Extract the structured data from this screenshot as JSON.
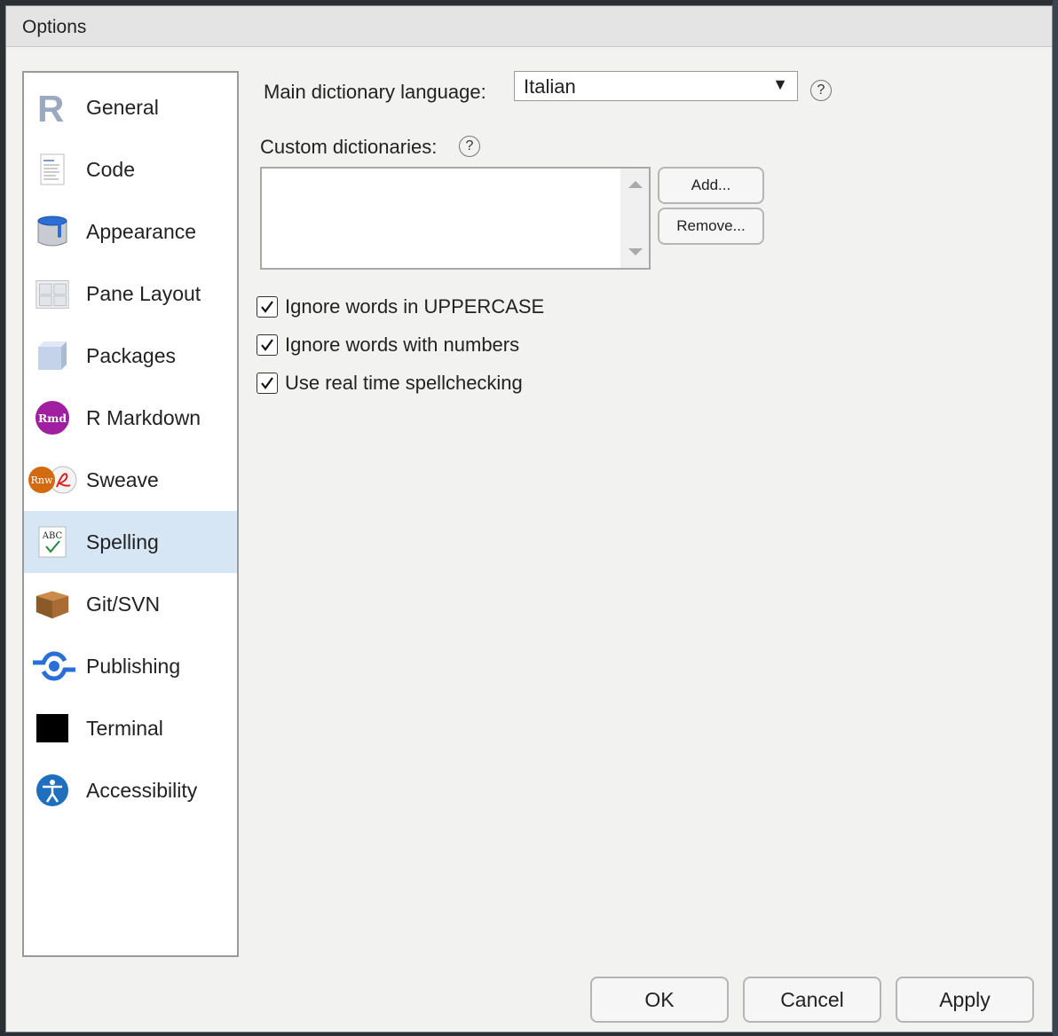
{
  "window": {
    "title": "Options"
  },
  "sidebar": {
    "items": [
      {
        "label": "General",
        "icon": "r-logo-icon"
      },
      {
        "label": "Code",
        "icon": "code-document-icon"
      },
      {
        "label": "Appearance",
        "icon": "paint-bucket-icon"
      },
      {
        "label": "Pane Layout",
        "icon": "pane-layout-icon"
      },
      {
        "label": "Packages",
        "icon": "package-cube-icon"
      },
      {
        "label": "R Markdown",
        "icon": "rmd-icon"
      },
      {
        "label": "Sweave",
        "icon": "sweave-pdf-icon"
      },
      {
        "label": "Spelling",
        "icon": "abc-check-icon",
        "selected": true
      },
      {
        "label": "Git/SVN",
        "icon": "box-icon"
      },
      {
        "label": "Publishing",
        "icon": "publishing-icon"
      },
      {
        "label": "Terminal",
        "icon": "terminal-icon"
      },
      {
        "label": "Accessibility",
        "icon": "accessibility-icon"
      }
    ]
  },
  "spelling": {
    "main_dictionary_label": "Main dictionary language:",
    "main_dictionary_value": "Italian",
    "custom_dictionaries_label": "Custom dictionaries:",
    "add_button": "Add...",
    "remove_button": "Remove...",
    "options": [
      {
        "label": "Ignore words in UPPERCASE",
        "checked": true
      },
      {
        "label": "Ignore words with numbers",
        "checked": true
      },
      {
        "label": "Use real time spellchecking",
        "checked": true
      }
    ],
    "help_glyph": "?"
  },
  "footer": {
    "ok": "OK",
    "cancel": "Cancel",
    "apply": "Apply"
  },
  "colors": {
    "selected_bg": "#d6e6f5",
    "accent_blue": "#2a6fd6"
  }
}
